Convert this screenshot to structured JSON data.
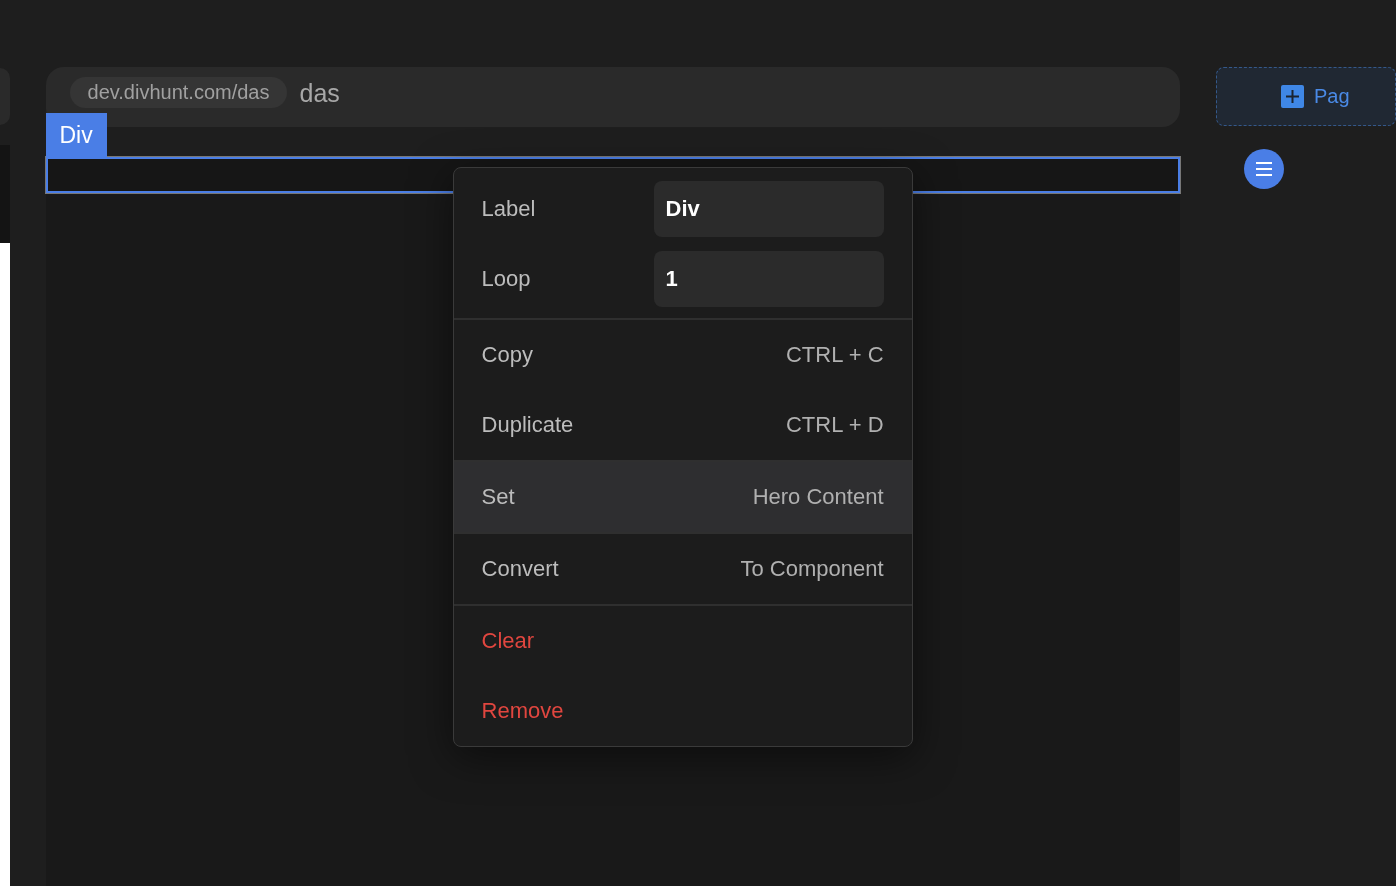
{
  "address_bar": {
    "url": "dev.divhunt.com/das",
    "page": "das"
  },
  "element_tag": "Div",
  "add_button": {
    "label": "Pag"
  },
  "context_menu": {
    "sections": [
      {
        "items": [
          {
            "kind": "field",
            "label": "Label",
            "value": "Div",
            "selected": false
          },
          {
            "kind": "field",
            "label": "Loop",
            "value": "1",
            "selected": false
          }
        ]
      },
      {
        "items": [
          {
            "kind": "action",
            "label": "Copy",
            "hint": "CTRL + C",
            "selected": false
          },
          {
            "kind": "action",
            "label": "Duplicate",
            "hint": "CTRL + D",
            "selected": false
          }
        ]
      },
      {
        "items": [
          {
            "kind": "action",
            "label": "Set",
            "hint": "Hero Content",
            "selected": true
          }
        ]
      },
      {
        "items": [
          {
            "kind": "action",
            "label": "Convert",
            "hint": "To Component",
            "selected": false
          }
        ]
      },
      {
        "items": [
          {
            "kind": "danger",
            "label": "Clear",
            "selected": false
          },
          {
            "kind": "danger",
            "label": "Remove",
            "selected": false
          }
        ]
      }
    ]
  }
}
